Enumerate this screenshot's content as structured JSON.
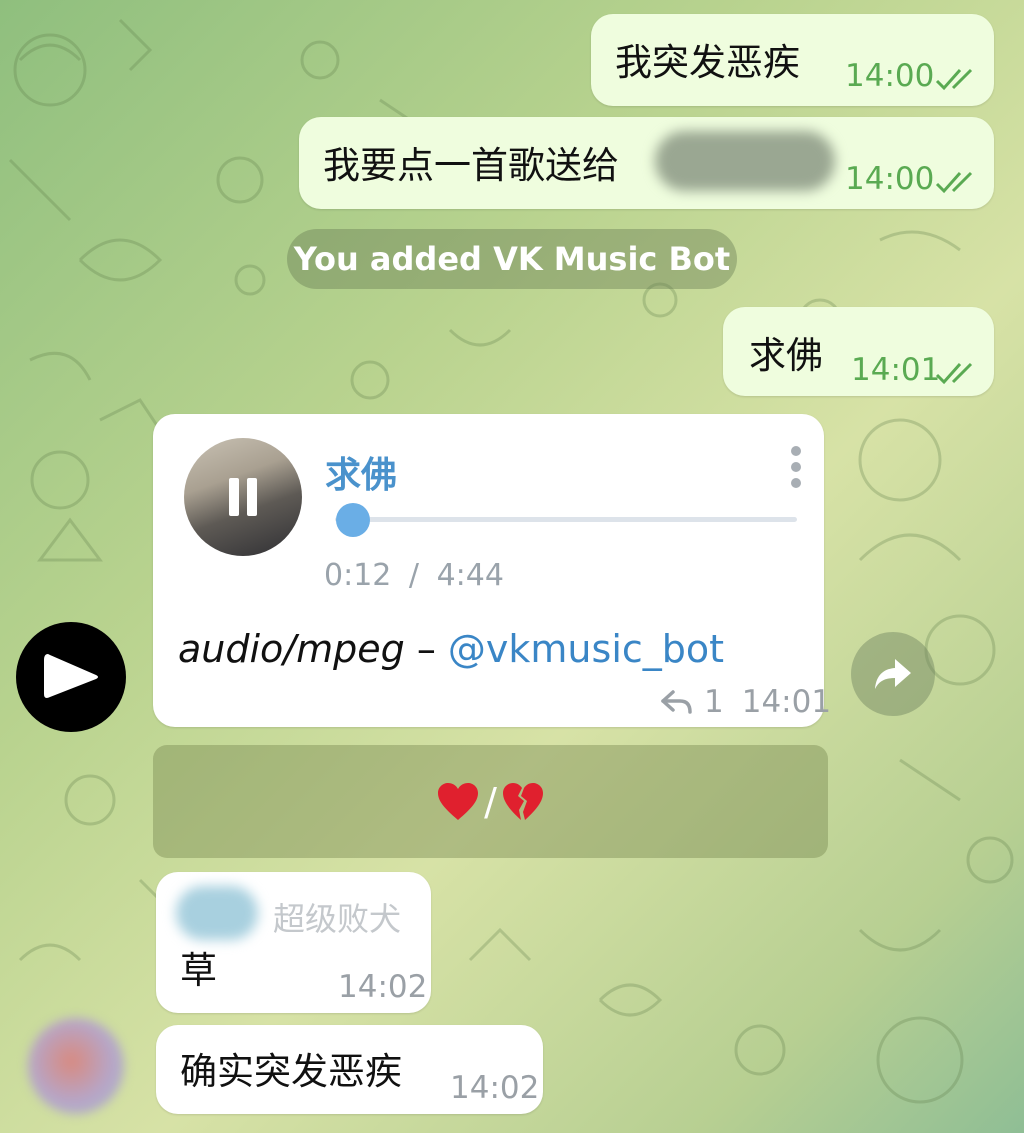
{
  "messages": {
    "out1": {
      "text": "我突发恶疾",
      "time": "14:00"
    },
    "out2": {
      "text": "我要点一首歌送给",
      "time": "14:00"
    },
    "service": {
      "text": "You added VK Music Bot"
    },
    "out3": {
      "text": "求佛",
      "time": "14:01"
    },
    "audio": {
      "title": "求佛",
      "progress": "0:12",
      "separator": "/",
      "duration": "4:44",
      "progress_fraction": 0.04,
      "caption_type": "audio/mpeg",
      "caption_dash": " – ",
      "caption_link": "@vkmusic_bot",
      "reply_count": "1",
      "time": "14:01"
    },
    "reaction_panel": {
      "text": "/",
      "icons": [
        "red-heart",
        "broken-heart"
      ]
    },
    "in1": {
      "sender": "超级败犬",
      "text": "草",
      "time": "14:02"
    },
    "in2": {
      "text": "确实突发恶疾",
      "time": "14:02"
    }
  },
  "colors": {
    "outgoing_bubble": "#effdde",
    "incoming_bubble": "#ffffff",
    "outgoing_time": "#5aaa52",
    "link": "#3a86c6",
    "audio_accent": "#6aaee6"
  }
}
